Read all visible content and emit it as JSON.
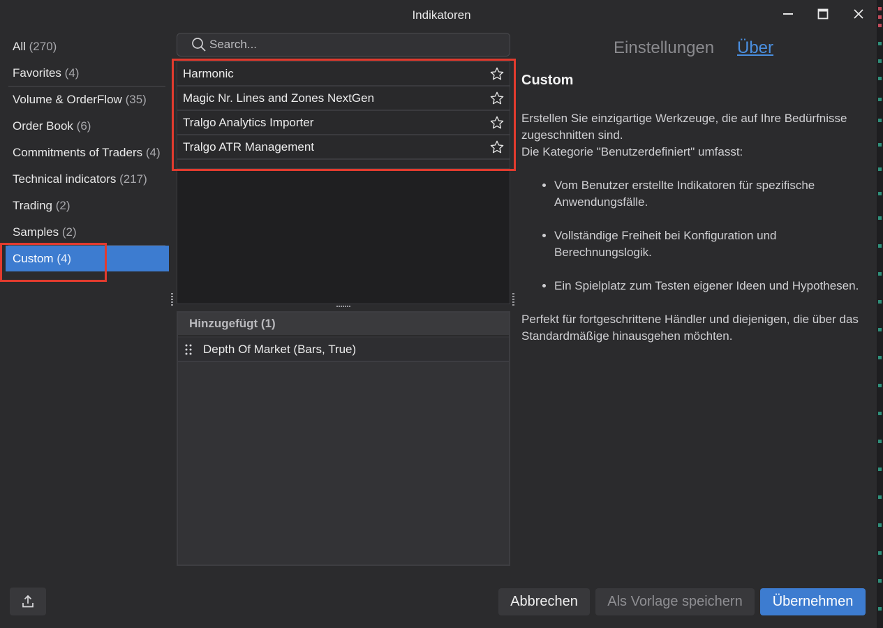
{
  "window": {
    "title": "Indikatoren",
    "controls": [
      "minimize-icon",
      "maximize-icon",
      "close-icon"
    ]
  },
  "categories": [
    {
      "label": "All",
      "count": "(270)"
    },
    {
      "label": "Favorites",
      "count": "(4)"
    },
    {
      "label": "Volume & OrderFlow",
      "count": "(35)"
    },
    {
      "label": "Order Book",
      "count": "(6)"
    },
    {
      "label": "Commitments of Traders",
      "count": "(4)"
    },
    {
      "label": "Technical indicators",
      "count": "(217)"
    },
    {
      "label": "Trading",
      "count": "(2)"
    },
    {
      "label": "Samples",
      "count": "(2)"
    },
    {
      "label": "Custom",
      "count": "(4)",
      "selected": true
    }
  ],
  "search": {
    "placeholder": "Search...",
    "value": ""
  },
  "indicators": [
    {
      "label": "Harmonic"
    },
    {
      "label": "Magic Nr. Lines and Zones NextGen"
    },
    {
      "label": "Tralgo Analytics Importer"
    },
    {
      "label": "Tralgo ATR Management"
    }
  ],
  "added": {
    "header": "Hinzugefügt (1)",
    "items": [
      {
        "label": "Depth Of Market (Bars, True)"
      }
    ]
  },
  "tabs": {
    "settings": "Einstellungen",
    "about": "Über",
    "active": "about"
  },
  "about": {
    "title": "Custom",
    "intro_line1": "Erstellen Sie einzigartige Werkzeuge, die auf Ihre Bedürfnisse zugeschnitten sind.",
    "intro_line2": "Die Kategorie \"Benutzerdefiniert\" umfasst:",
    "bullets": [
      "Vom Benutzer erstellte Indikatoren für spezifische Anwendungsfälle.",
      "Vollständige Freiheit bei Konfiguration und Berechnungslogik.",
      "Ein Spielplatz zum Testen eigener Ideen und Hypothesen."
    ],
    "closing": "Perfekt für fortgeschrittene Händler und diejenigen, die über das Standardmäßige hinausgehen möchten."
  },
  "footer": {
    "cancel": "Abbrechen",
    "save_template": "Als Vorlage speichern",
    "apply": "Übernehmen"
  },
  "colors": {
    "background": "#2b2b2d",
    "accent": "#3d7cd0",
    "link": "#4a8fe0",
    "highlight": "#e23b2e"
  }
}
